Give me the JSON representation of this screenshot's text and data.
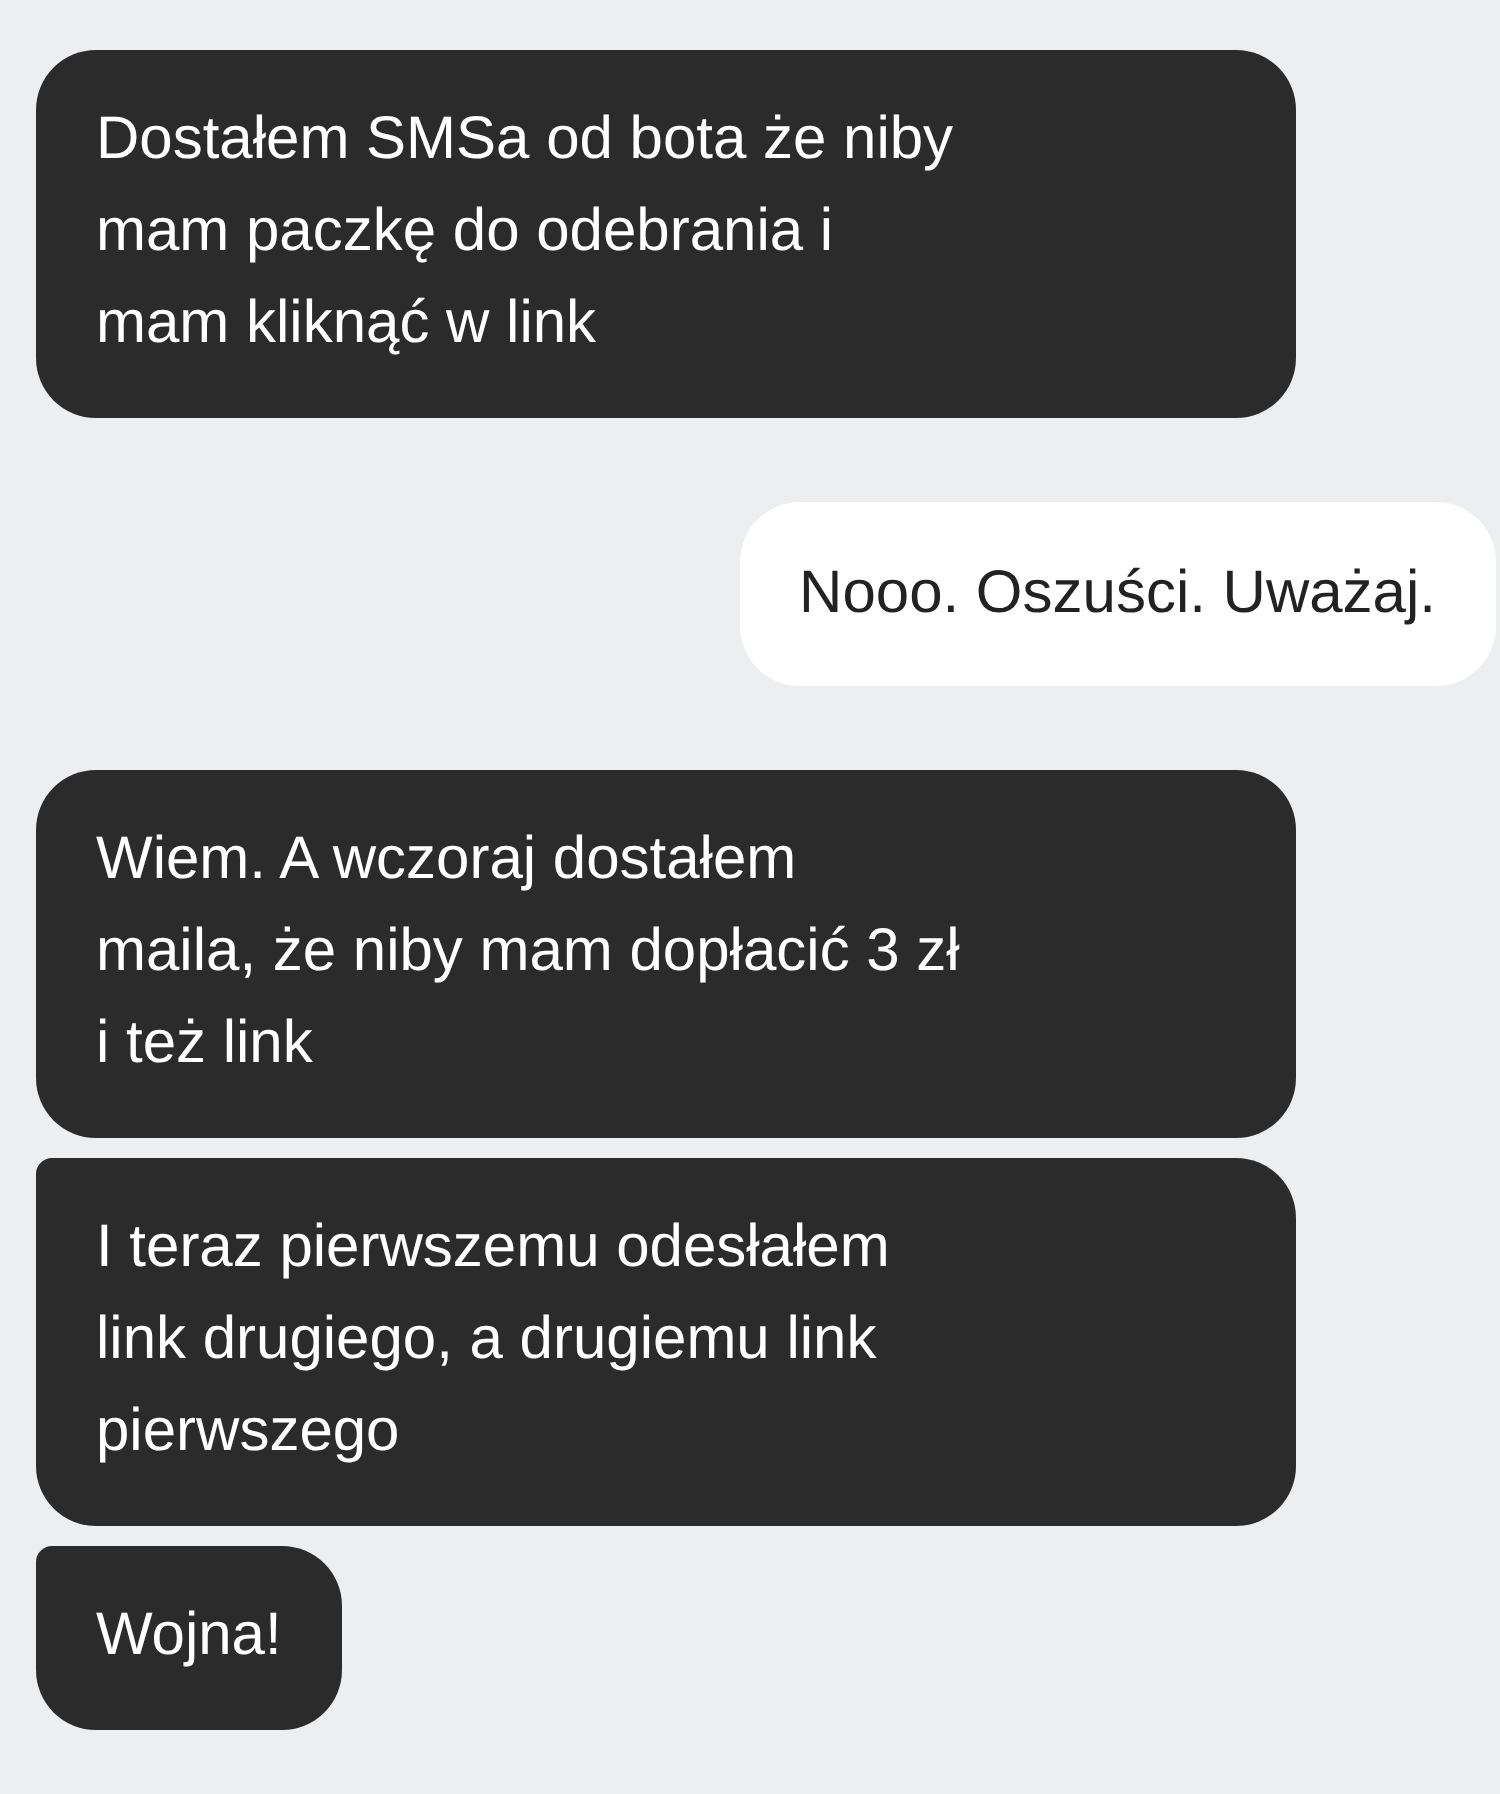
{
  "messages": [
    {
      "kind": "incoming",
      "text": "Dostałem SMSa od bota że niby\nmam paczkę do odebrania i\nmam kliknąć w link"
    },
    {
      "kind": "outgoing",
      "text": "Nooo. Oszuści. Uważaj."
    },
    {
      "kind": "incoming",
      "text": "Wiem. A wczoraj dostałem\nmaila, że niby mam dopłacić 3 zł\ni też link"
    },
    {
      "kind": "incoming",
      "text": "I teraz pierwszemu odesłałem\nlink drugiego, a drugiemu link\npierwszego"
    },
    {
      "kind": "incoming",
      "text": "Wojna!"
    }
  ]
}
